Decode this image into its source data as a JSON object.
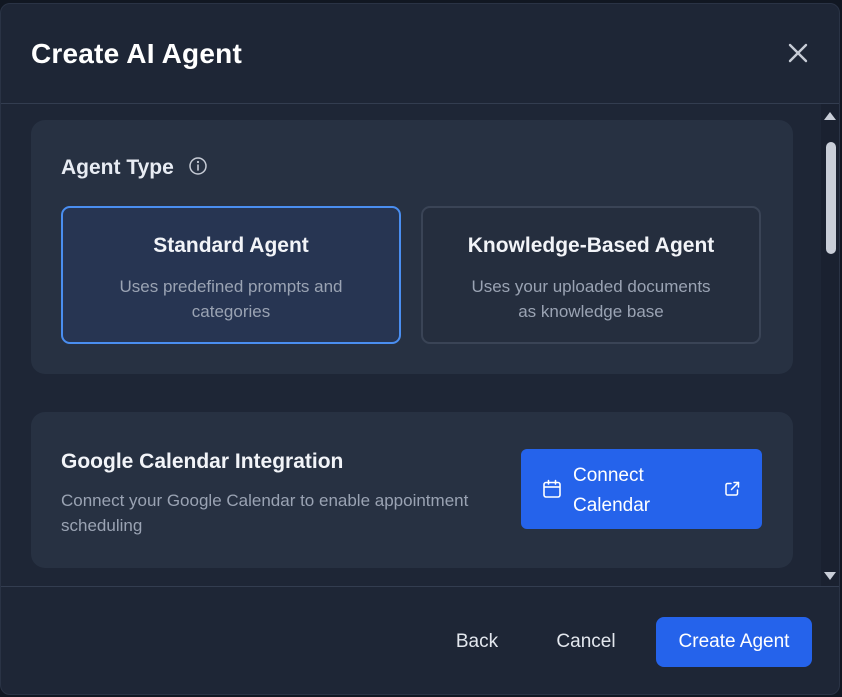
{
  "modal": {
    "title": "Create AI Agent",
    "close_icon": "close-icon"
  },
  "agent_type": {
    "label": "Agent Type",
    "info_icon": "info-icon",
    "options": [
      {
        "title": "Standard Agent",
        "description": "Uses predefined prompts and categories",
        "selected": true
      },
      {
        "title": "Knowledge-Based Agent",
        "description": "Uses your uploaded documents as knowledge base",
        "selected": false
      }
    ]
  },
  "calendar": {
    "title": "Google Calendar Integration",
    "description": "Connect your Google Calendar to enable appointment scheduling",
    "button_label": "Connect Calendar",
    "button_icon": "calendar-icon",
    "button_trailing_icon": "external-link-icon"
  },
  "footer": {
    "back_label": "Back",
    "cancel_label": "Cancel",
    "create_label": "Create Agent"
  },
  "colors": {
    "accent": "#2563eb",
    "selected_border": "#4a8ef0",
    "modal_bg": "#1e2636",
    "section_bg": "#273142"
  }
}
